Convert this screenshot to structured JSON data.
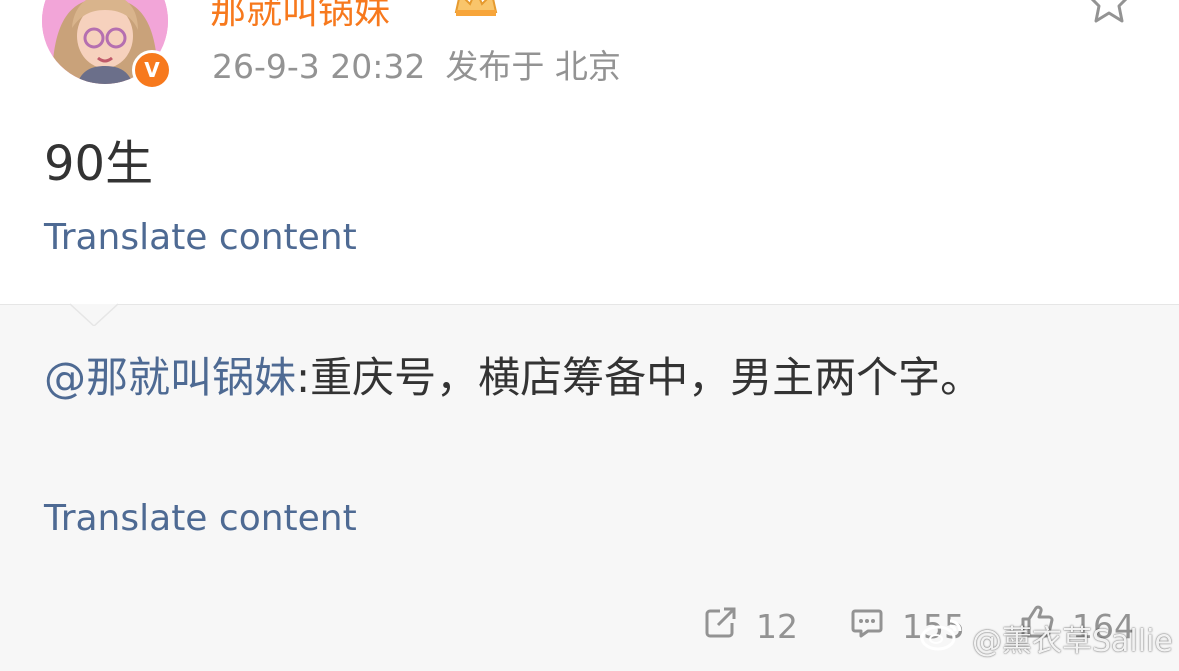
{
  "post": {
    "username": "那就叫锅妹",
    "timestamp": "26-9-3 20:32",
    "location": "发布于 北京",
    "verified_badge": "V",
    "text": "90生",
    "translate_label": "Translate content"
  },
  "repost": {
    "mention": "@那就叫锅妹",
    "text": ":重庆号，横店筹备中，男主两个字。",
    "translate_label": "Translate content"
  },
  "actions": {
    "share_count": "12",
    "comment_count": "155",
    "like_count": "164"
  },
  "watermark": "@薰衣草Sallie",
  "colors": {
    "accent_orange": "#f7791d",
    "link_blue": "#4e6a93",
    "text_dark": "#333333",
    "text_gray": "#939393",
    "repost_bg": "#f7f7f7"
  },
  "icons": [
    "crown-icon",
    "star-icon",
    "share-icon",
    "comment-icon",
    "like-icon",
    "weibo-logo-icon"
  ]
}
